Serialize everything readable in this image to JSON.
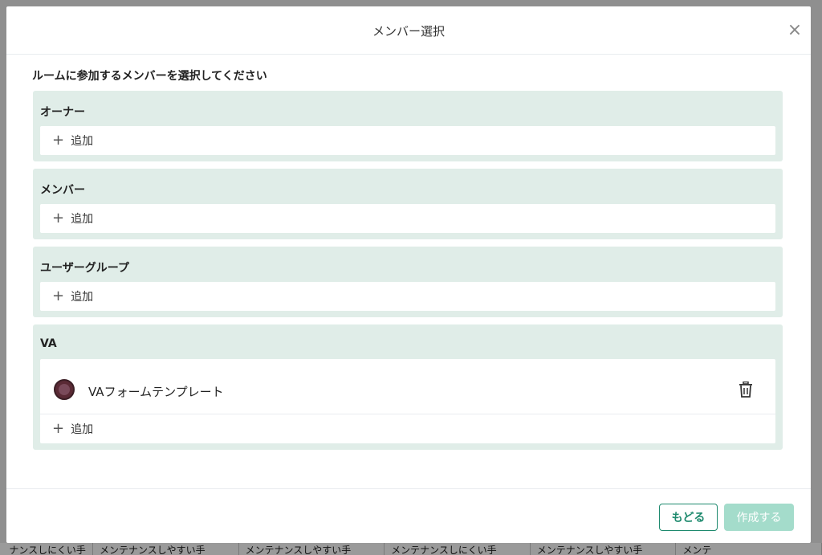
{
  "dialog": {
    "title": "メンバー選択",
    "close_symbol": "×",
    "instruction": "ルームに参加するメンバーを選択してください"
  },
  "sections": [
    {
      "title": "オーナー",
      "add_label": "追加"
    },
    {
      "title": "メンバー",
      "add_label": "追加"
    },
    {
      "title": "ユーザーグループ",
      "add_label": "追加"
    },
    {
      "title": "VA",
      "add_label": "追加",
      "members": [
        {
          "name": "VAフォームテンプレート",
          "icon": "avatar-icon"
        }
      ]
    }
  ],
  "icons": {
    "plus": "+",
    "trash": "trash-icon",
    "close": "close-icon"
  },
  "footer": {
    "back_label": "もどる",
    "create_label": "作成する"
  },
  "background": {
    "bottom_row": [
      "ナンスしにくい手",
      "メンテナンスしやすい手",
      "メンテナンスしやすい手",
      "メンテナンスしにくい手",
      "メンテナンスしやすい手",
      "メンテ"
    ]
  },
  "colors": {
    "accent": "#1e8a6e",
    "section_bg": "#e0ede8",
    "create_disabled": "#a4dccb"
  }
}
